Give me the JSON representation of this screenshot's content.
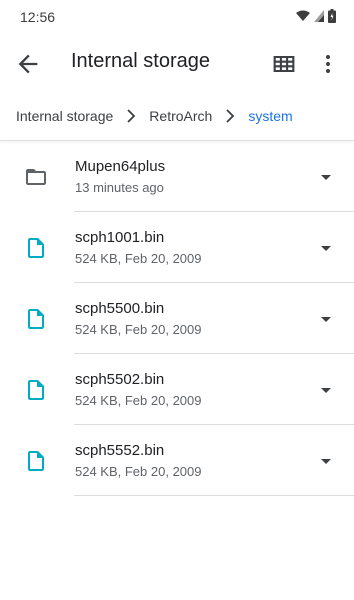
{
  "status": {
    "time": "12:56"
  },
  "app_bar": {
    "title": "Internal storage"
  },
  "breadcrumb": [
    "Internal storage",
    "RetroArch",
    "system"
  ],
  "files": [
    {
      "name": "Mupen64plus",
      "sub": "13 minutes ago",
      "type": "folder"
    },
    {
      "name": "scph1001.bin",
      "sub": "524 KB, Feb 20, 2009",
      "type": "file"
    },
    {
      "name": "scph5500.bin",
      "sub": "524 KB, Feb 20, 2009",
      "type": "file"
    },
    {
      "name": "scph5502.bin",
      "sub": "524 KB, Feb 20, 2009",
      "type": "file"
    },
    {
      "name": "scph5552.bin",
      "sub": "524 KB, Feb 20, 2009",
      "type": "file"
    }
  ],
  "colors": {
    "accent": "#1a73e8",
    "file_icon": "#00acc1",
    "folder_icon": "#5f6368"
  }
}
